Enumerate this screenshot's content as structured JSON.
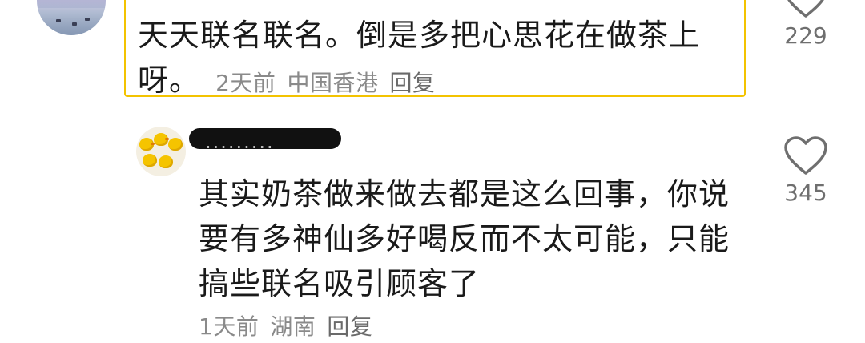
{
  "comments": [
    {
      "text": "天天联名联名。倒是多把心思花在做茶上呀。",
      "time": "2天前",
      "location": "中国香港",
      "reply_label": "回复",
      "likes": "229",
      "highlighted": true
    },
    {
      "username": "·········",
      "text": "其实奶茶做来做去都是这么回事，你说要有多神仙多好喝反而不太可能，只能搞些联名吸引顾客了",
      "time": "1天前",
      "location": "湖南",
      "reply_label": "回复",
      "likes": "345",
      "highlighted": false
    }
  ],
  "colors": {
    "highlight_border": "#f3c300",
    "meta_text": "#8a8a8a",
    "body_text": "#1a1a1a"
  },
  "icons": {
    "like": "heart-outline-icon"
  }
}
